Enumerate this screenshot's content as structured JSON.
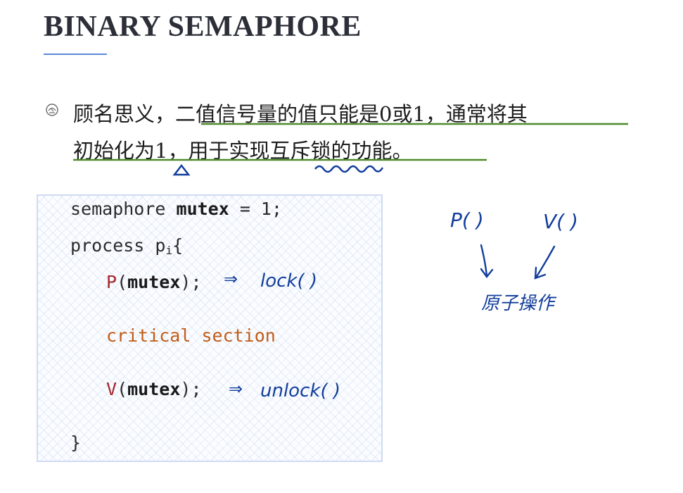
{
  "slide": {
    "title": "BINARY SEMAPHORE",
    "para_line1_a": "顾名思义，",
    "para_line1_b": "二值信号量的值只能是0或1，通常将其",
    "para_line2_a": "初始化为1，用于实现",
    "para_line2_b": "互斥锁",
    "para_line2_c": "的功能。"
  },
  "code": {
    "l1_pre": "semaphore ",
    "l1_var": "mutex",
    "l1_post": " = 1;",
    "l2_pre": "process p",
    "l2_sub": "i",
    "l2_post": "{",
    "l3_fn": "P",
    "l3_open": "(",
    "l3_var": "mutex",
    "l3_close": ");",
    "l4": "critical section",
    "l5_fn": "V",
    "l5_open": "(",
    "l5_var": "mutex",
    "l5_close": ");",
    "l6": "}"
  },
  "annotations": {
    "lock": "lock( )",
    "unlock": "unlock( )",
    "p_op": "P( )",
    "v_op": "V( )",
    "atomic": "原子操作",
    "arrow": "⇒"
  },
  "colors": {
    "title": "#2c2f38",
    "accent_rule": "#5b8ad6",
    "underline_green": "#4f8a2e",
    "ink_blue": "#123e9c",
    "code_red": "#a4262c",
    "code_orange": "#c15c17",
    "code_border": "#cfdaf3"
  }
}
